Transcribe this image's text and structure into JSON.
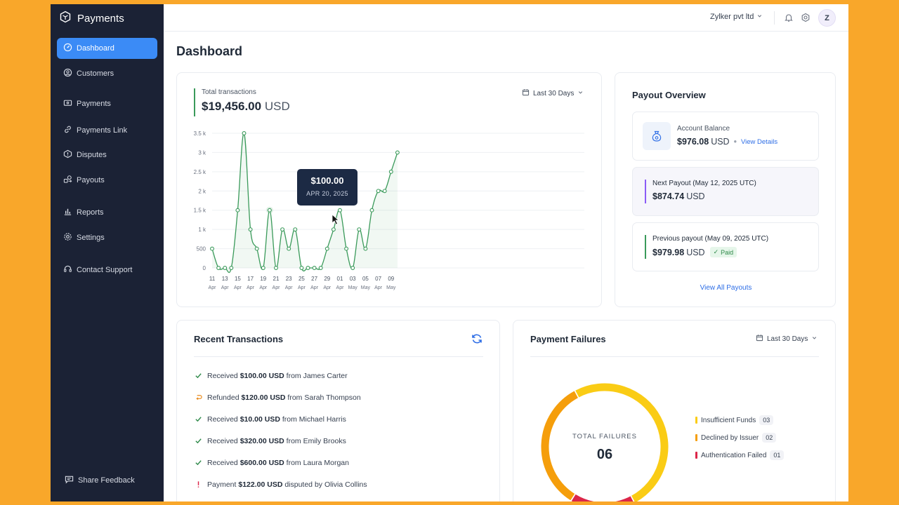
{
  "brand": {
    "name": "Payments"
  },
  "sidebar": {
    "items": [
      {
        "label": "Dashboard",
        "icon": "dashboard-icon"
      },
      {
        "label": "Customers",
        "icon": "customers-icon"
      },
      {
        "label": "Payments",
        "icon": "payments-icon"
      },
      {
        "label": "Payments Link",
        "icon": "link-icon"
      },
      {
        "label": "Disputes",
        "icon": "disputes-icon"
      },
      {
        "label": "Payouts",
        "icon": "payouts-icon"
      },
      {
        "label": "Reports",
        "icon": "reports-icon"
      },
      {
        "label": "Settings",
        "icon": "settings-icon"
      },
      {
        "label": "Contact Support",
        "icon": "headset-icon"
      }
    ],
    "feedback": "Share Feedback"
  },
  "topbar": {
    "org": "Zylker pvt ltd",
    "avatar": "Z"
  },
  "page": {
    "title": "Dashboard"
  },
  "transactions": {
    "label": "Total transactions",
    "total": "$19,456.00",
    "currency": "USD",
    "range": "Last 30 Days",
    "tooltip": {
      "value": "$100.00",
      "date": "APR 20, 2025"
    }
  },
  "chart_data": {
    "type": "area",
    "x": [
      "11 Apr",
      "12 Apr",
      "13 Apr",
      "14 Apr",
      "15 Apr",
      "16 Apr",
      "17 Apr",
      "18 Apr",
      "19 Apr",
      "20 Apr",
      "21 Apr",
      "22 Apr",
      "23 Apr",
      "24 Apr",
      "25 Apr",
      "26 Apr",
      "27 Apr",
      "28 Apr",
      "29 Apr",
      "30 Apr",
      "01 May",
      "02 May",
      "03 May",
      "04 May",
      "05 May",
      "06 May",
      "07 May",
      "08 May",
      "09 May",
      "10 May"
    ],
    "series": [
      {
        "values": [
          500,
          0,
          0,
          0,
          1500,
          3500,
          1000,
          500,
          0,
          1500,
          0,
          1000,
          500,
          1000,
          0,
          0,
          0,
          0,
          500,
          1000,
          1500,
          500,
          0,
          1000,
          500,
          1500,
          2000,
          2000,
          2500,
          3000
        ]
      }
    ],
    "xticks": [
      {
        "day": "11",
        "month": "Apr"
      },
      {
        "day": "13",
        "month": "Apr"
      },
      {
        "day": "15",
        "month": "Apr"
      },
      {
        "day": "17",
        "month": "Apr"
      },
      {
        "day": "19",
        "month": "Apr"
      },
      {
        "day": "21",
        "month": "Apr"
      },
      {
        "day": "23",
        "month": "Apr"
      },
      {
        "day": "25",
        "month": "Apr"
      },
      {
        "day": "27",
        "month": "Apr"
      },
      {
        "day": "29",
        "month": "Apr"
      },
      {
        "day": "01",
        "month": "Apr"
      },
      {
        "day": "03",
        "month": "May"
      },
      {
        "day": "05",
        "month": "May"
      },
      {
        "day": "07",
        "month": "Apr"
      },
      {
        "day": "09",
        "month": "May"
      }
    ],
    "yticks": [
      "0",
      "500",
      "1 k",
      "1.5 k",
      "2 k",
      "2.5 k",
      "3 k",
      "3.5 k"
    ],
    "ylim": [
      0,
      3500
    ],
    "color": "#3a9a5a",
    "grid": true,
    "highlight_index": 9
  },
  "payout": {
    "title": "Payout Overview",
    "balance": {
      "label": "Account Balance",
      "amount": "$976.08",
      "currency": "USD",
      "link": "View Details"
    },
    "next": {
      "label": "Next Payout",
      "date": "(May 12, 2025 UTC)",
      "amount": "$874.74",
      "currency": "USD",
      "accent": "#8b5cf6"
    },
    "previous": {
      "label": "Previous payout",
      "date": "(May 09, 2025 UTC)",
      "amount": "$979.98",
      "currency": "USD",
      "status": "Paid",
      "accent": "#3a9a5a"
    },
    "view_all": "View All Payouts"
  },
  "recent": {
    "title": "Recent Transactions",
    "items": [
      {
        "type": "received",
        "verb": "Received",
        "amount": "$100.00 USD",
        "rest": "from James Carter"
      },
      {
        "type": "refunded",
        "verb": "Refunded",
        "amount": "$120.00 USD",
        "rest": "from Sarah Thompson"
      },
      {
        "type": "received",
        "verb": "Received",
        "amount": "$10.00 USD",
        "rest": "from Michael Harris"
      },
      {
        "type": "received",
        "verb": "Received",
        "amount": "$320.00 USD",
        "rest": "from Emily Brooks"
      },
      {
        "type": "received",
        "verb": "Received",
        "amount": "$600.00 USD",
        "rest": "from Laura Morgan"
      },
      {
        "type": "disputed",
        "verb": "Payment",
        "amount": "$122.00 USD",
        "rest": "disputed by Olivia Collins"
      }
    ]
  },
  "failures": {
    "title": "Payment Failures",
    "range": "Last 30 Days",
    "center_label": "TOTAL FAILURES",
    "total": "06",
    "legend": [
      {
        "label": "Insufficient Funds",
        "count": "03",
        "color": "#FACC15"
      },
      {
        "label": "Declined by Issuer",
        "count": "02",
        "color": "#F59E0B"
      },
      {
        "label": "Authentication Failed",
        "count": "01",
        "color": "#DC2649"
      }
    ]
  }
}
